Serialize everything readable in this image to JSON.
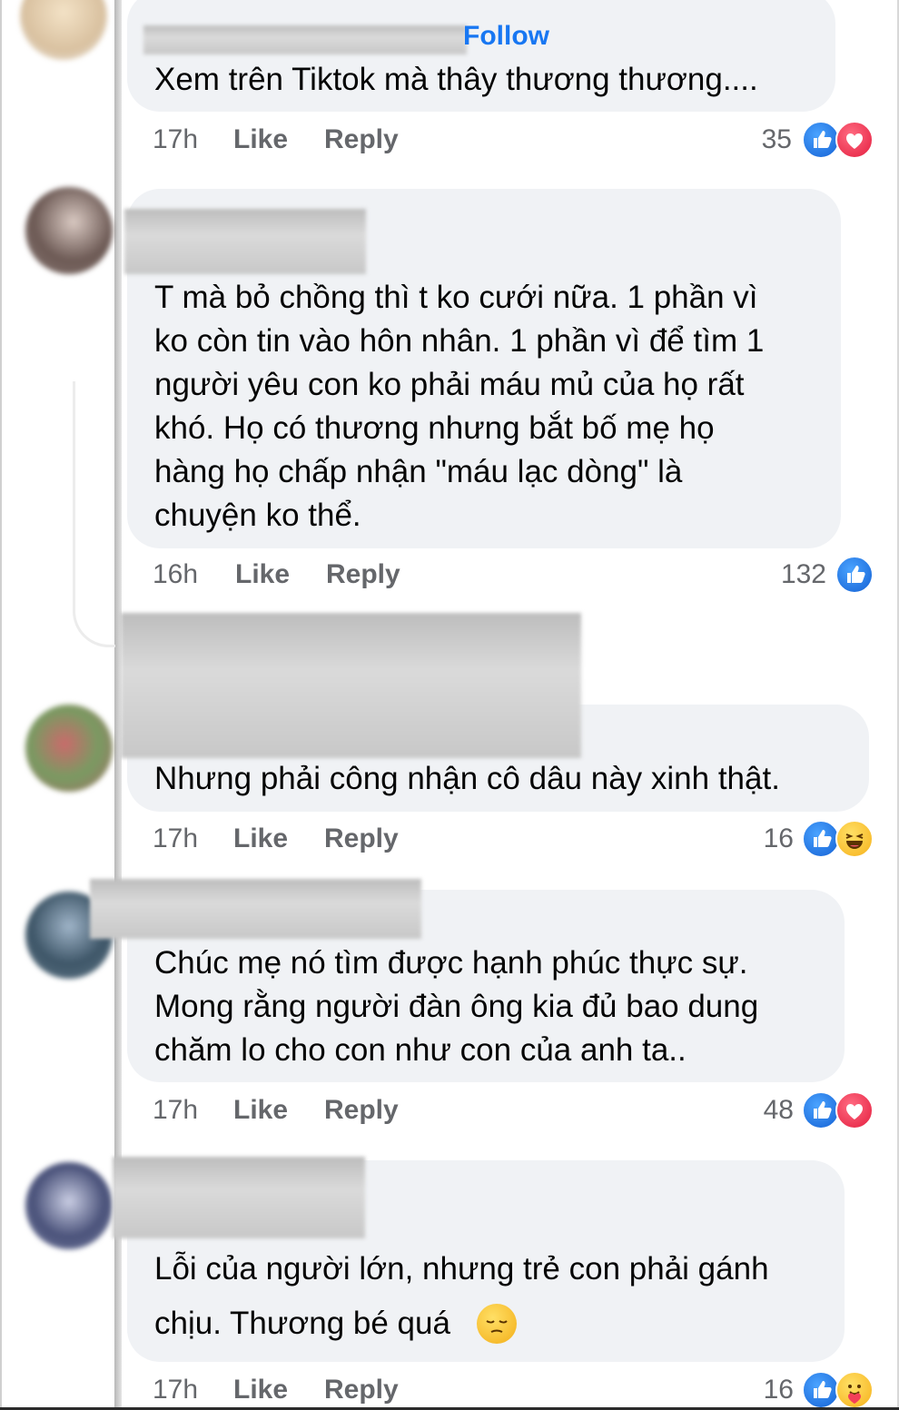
{
  "comments": [
    {
      "follow_label": "Follow",
      "text": "Xem trên Tiktok mà thây thương thương....",
      "time": "17h",
      "like_label": "Like",
      "reply_label": "Reply",
      "reaction_count": "35",
      "reactions": [
        "like-icon",
        "love-icon"
      ]
    },
    {
      "text": "T mà bỏ chồng thì t ko cưới nữa. 1 phần vì\nko còn tin vào hôn nhân. 1 phần vì để tìm 1\nngười yêu con ko phải máu mủ của họ rất\nkhó. Họ có thương nhưng bắt bố mẹ họ\nhàng họ chấp nhận \"máu lạc dòng\" là\nchuyện ko thể.",
      "time": "16h",
      "like_label": "Like",
      "reply_label": "Reply",
      "reaction_count": "132",
      "reactions": [
        "like-icon"
      ]
    },
    {
      "text": "Nhưng phải công nhận cô dâu này xinh thật.",
      "time": "17h",
      "like_label": "Like",
      "reply_label": "Reply",
      "reaction_count": "16",
      "reactions": [
        "like-icon",
        "haha-icon"
      ]
    },
    {
      "text": "Chúc mẹ nó tìm được hạnh phúc thực sự.\nMong rằng người đàn ông kia đủ bao dung\nchăm lo cho con như con của anh ta..",
      "time": "17h",
      "like_label": "Like",
      "reply_label": "Reply",
      "reaction_count": "48",
      "reactions": [
        "like-icon",
        "love-icon"
      ]
    },
    {
      "text_line1": "Lỗi của người lớn, nhưng trẻ con phải gánh",
      "text_line2": "chịu. Thương bé quá",
      "inline_emoji": "sad-face-icon",
      "time": "17h",
      "like_label": "Like",
      "reply_label": "Reply",
      "reaction_count": "16",
      "reactions": [
        "like-icon",
        "care-icon"
      ]
    }
  ],
  "colors": {
    "bubble": "#f0f2f5",
    "meta_text": "#65676b",
    "link_blue": "#1877f2",
    "like_blue": "#1877f2",
    "love_red": "#f33e58"
  }
}
